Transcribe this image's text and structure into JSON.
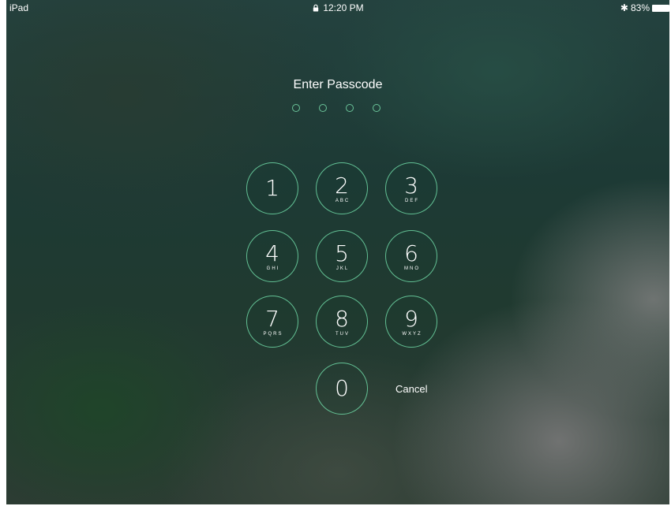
{
  "status_bar": {
    "device": "iPad",
    "time": "12:20 PM",
    "bluetooth": "✱",
    "battery": "83%"
  },
  "lock_screen": {
    "title": "Enter Passcode",
    "passcode_dots": 4,
    "keys": [
      {
        "digit": "1",
        "letters": ""
      },
      {
        "digit": "2",
        "letters": "ABC"
      },
      {
        "digit": "3",
        "letters": "DEF"
      },
      {
        "digit": "4",
        "letters": "GHI"
      },
      {
        "digit": "5",
        "letters": "JKL"
      },
      {
        "digit": "6",
        "letters": "MNO"
      },
      {
        "digit": "7",
        "letters": "PQRS"
      },
      {
        "digit": "8",
        "letters": "TUV"
      },
      {
        "digit": "9",
        "letters": "WXYZ"
      },
      {
        "digit": "0",
        "letters": ""
      }
    ],
    "cancel_label": "Cancel"
  },
  "colors": {
    "accent": "#6ed7a5",
    "text": "#ffffff"
  }
}
